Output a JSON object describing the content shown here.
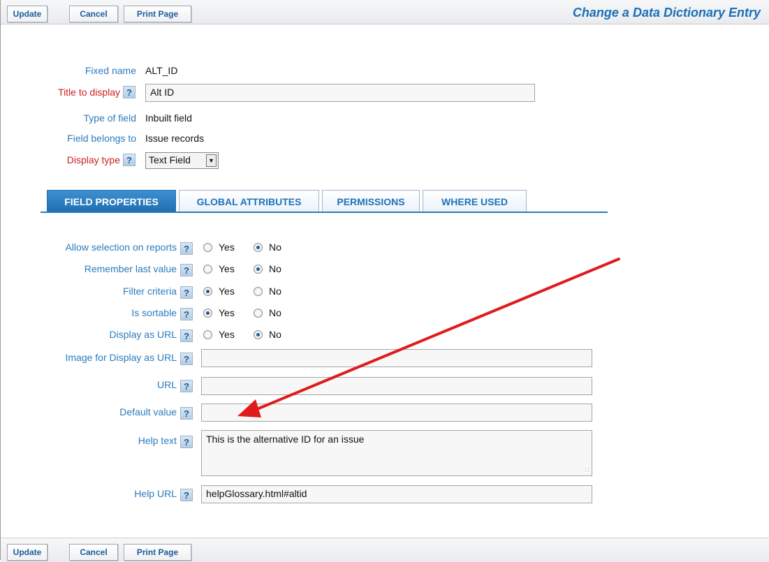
{
  "toolbar": {
    "update_label": "Update",
    "cancel_label": "Cancel",
    "print_label": "Print Page",
    "page_title": "Change a Data Dictionary Entry"
  },
  "header_fields": {
    "fixed_name_label": "Fixed name",
    "fixed_name_value": "ALT_ID",
    "title_label": "Title to display",
    "title_value": "Alt ID",
    "type_label": "Type of field",
    "type_value": "Inbuilt field",
    "belongs_label": "Field belongs to",
    "belongs_value": "Issue records",
    "display_type_label": "Display type",
    "display_type_value": "Text Field"
  },
  "help_glyph": "?",
  "tabs": [
    {
      "label": "FIELD PROPERTIES",
      "active": true
    },
    {
      "label": "GLOBAL ATTRIBUTES",
      "active": false
    },
    {
      "label": "PERMISSIONS",
      "active": false
    },
    {
      "label": "WHERE USED",
      "active": false
    }
  ],
  "radio_options": {
    "yes": "Yes",
    "no": "No"
  },
  "properties": [
    {
      "label": "Allow selection on reports",
      "value": "No"
    },
    {
      "label": "Remember last value",
      "value": "No"
    },
    {
      "label": "Filter criteria",
      "value": "Yes"
    },
    {
      "label": "Is sortable",
      "value": "Yes"
    },
    {
      "label": "Display as URL",
      "value": "No"
    }
  ],
  "text_fields": {
    "image_url_label": "Image for Display as URL",
    "image_url_value": "",
    "url_label": "URL",
    "url_value": "",
    "default_label": "Default value",
    "default_value": "",
    "help_text_label": "Help text",
    "help_text_value": "This is the alternative ID for an issue",
    "help_url_label": "Help URL",
    "help_url_value": "helpGlossary.html#altid"
  },
  "colors": {
    "accent": "#2b7bbf",
    "required_label": "#cc1f1f",
    "annotation_arrow": "#e01b1b"
  }
}
